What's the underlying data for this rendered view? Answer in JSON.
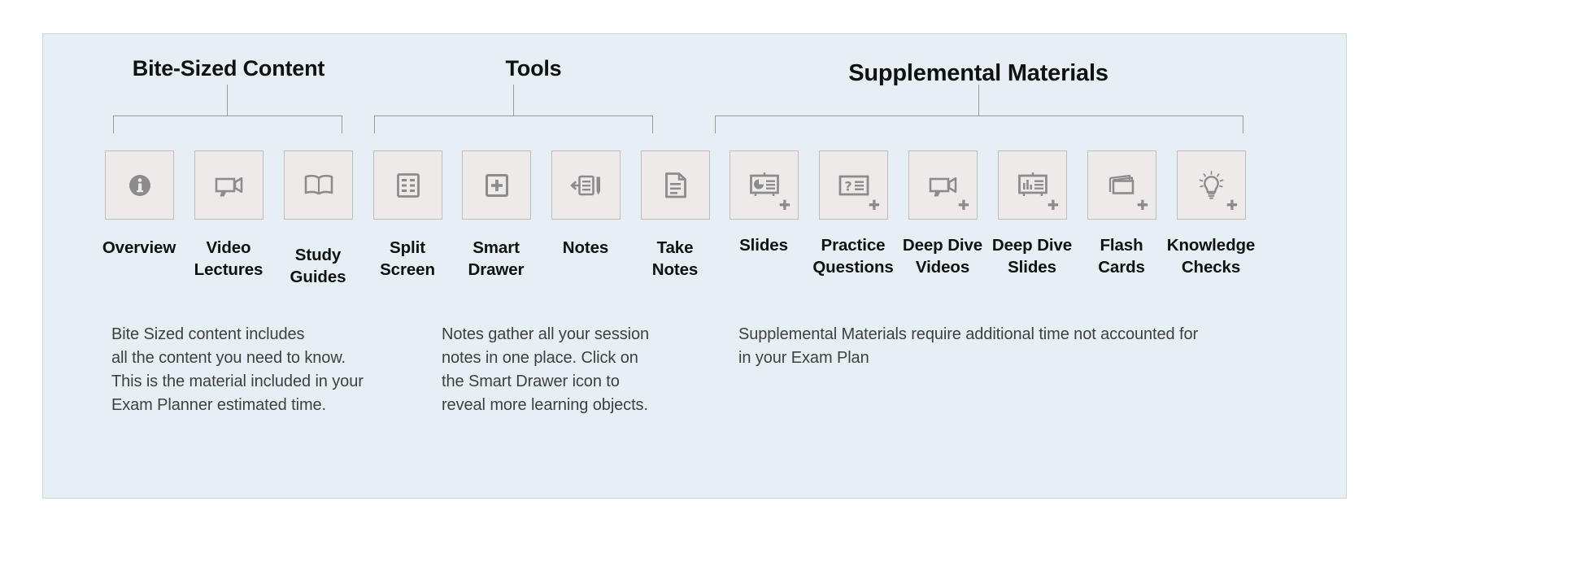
{
  "panel": {
    "background_color": "#e5eff4",
    "border_color": "#c9d6dc"
  },
  "groups": [
    {
      "id": "bite",
      "title": "Bite-Sized Content"
    },
    {
      "id": "tools",
      "title": "Tools"
    },
    {
      "id": "supp",
      "title": "Supplemental Materials"
    }
  ],
  "items": [
    {
      "label": "Overview",
      "icon": "info-circle-icon",
      "group": "bite",
      "plus": false
    },
    {
      "label": "Video\nLectures",
      "icon": "video-camera-icon",
      "group": "bite",
      "plus": false
    },
    {
      "label": "Study\nGuides",
      "icon": "open-book-icon",
      "group": "bite",
      "plus": false
    },
    {
      "label": "Split\nScreen",
      "icon": "split-screen-grid-icon",
      "group": "tools",
      "plus": false
    },
    {
      "label": "Smart\nDrawer",
      "icon": "square-plus-icon",
      "group": "tools",
      "plus": false
    },
    {
      "label": "Notes",
      "icon": "notes-pencil-arrow-icon",
      "group": "tools",
      "plus": false
    },
    {
      "label": "Take\nNotes",
      "icon": "document-page-icon",
      "group": "tools",
      "plus": false
    },
    {
      "label": "Slides",
      "icon": "presentation-pie-icon",
      "group": "supp",
      "plus": true
    },
    {
      "label": "Practice\nQuestions",
      "icon": "question-card-icon",
      "group": "supp",
      "plus": true
    },
    {
      "label": "Deep Dive\nVideos",
      "icon": "video-camera-icon",
      "group": "supp",
      "plus": true
    },
    {
      "label": "Deep Dive\nSlides",
      "icon": "presentation-bar-icon",
      "group": "supp",
      "plus": true
    },
    {
      "label": "Flash\nCards",
      "icon": "stacked-cards-icon",
      "group": "supp",
      "plus": true
    },
    {
      "label": "Knowledge\nChecks",
      "icon": "lightbulb-icon",
      "group": "supp",
      "plus": true
    }
  ],
  "plus_badge_glyph": "✚",
  "descriptions": {
    "bite": "Bite Sized content includes\nall the content you need to know.\nThis is the material included in your\nExam Planner estimated time.",
    "tools": "Notes gather all your session\nnotes in one place. Click on\nthe Smart Drawer icon to\nreveal  more learning objects.",
    "supp": "Supplemental Materials require additional time not accounted for\nin your Exam Plan"
  }
}
